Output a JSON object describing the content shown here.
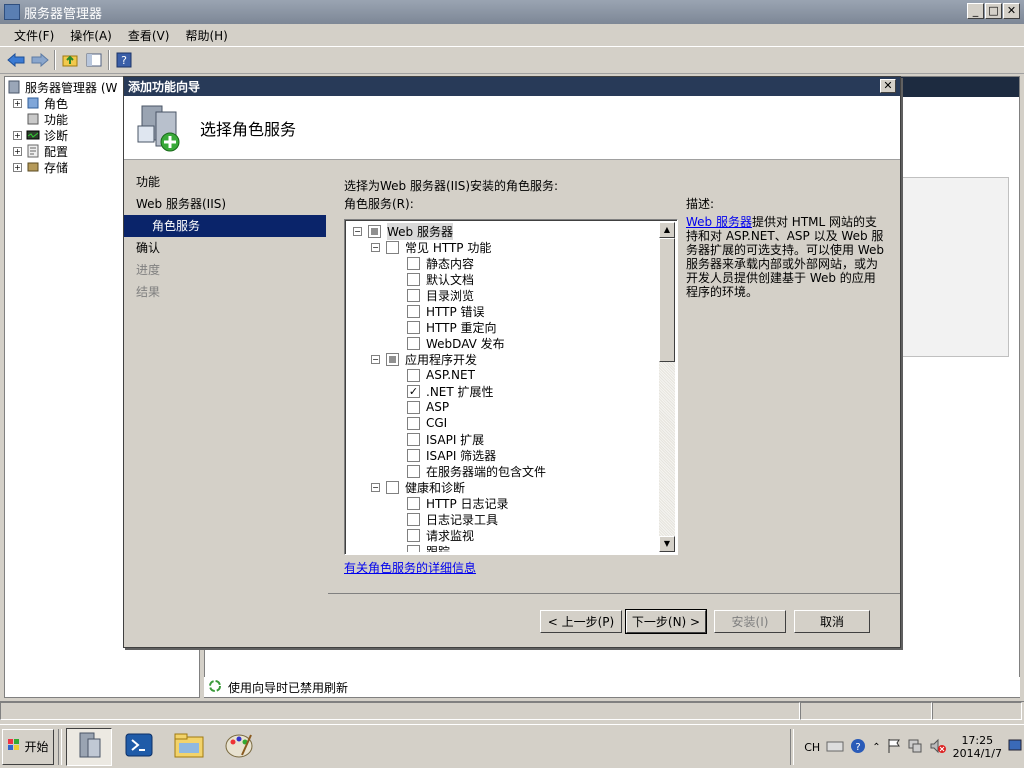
{
  "window": {
    "title": "服务器管理器"
  },
  "menu": [
    "文件(F)",
    "操作(A)",
    "查看(V)",
    "帮助(H)"
  ],
  "tree": {
    "root": "服务器管理器 (W",
    "items": [
      "角色",
      "功能",
      "诊断",
      "配置",
      "存储"
    ]
  },
  "background_status": "使用向导时已禁用刷新",
  "dialog": {
    "title": "添加功能向导",
    "header": "选择角色服务",
    "steps": [
      "功能",
      "Web 服务器(IIS)",
      "角色服务",
      "确认",
      "进度",
      "结果"
    ],
    "prompt": "选择为Web 服务器(IIS)安装的角色服务:",
    "list_label": "角色服务(R):",
    "list_items": [
      {
        "level": 0,
        "expand": "−",
        "check": "partial",
        "label": "Web 服务器"
      },
      {
        "level": 1,
        "expand": "−",
        "check": "unchecked",
        "label": "常见 HTTP 功能"
      },
      {
        "level": 2,
        "check": "unchecked",
        "label": "静态内容"
      },
      {
        "level": 2,
        "check": "unchecked",
        "label": "默认文档"
      },
      {
        "level": 2,
        "check": "unchecked",
        "label": "目录浏览"
      },
      {
        "level": 2,
        "check": "unchecked",
        "label": "HTTP 错误"
      },
      {
        "level": 2,
        "check": "unchecked",
        "label": "HTTP 重定向"
      },
      {
        "level": 2,
        "check": "unchecked",
        "label": "WebDAV 发布"
      },
      {
        "level": 1,
        "expand": "−",
        "check": "partial",
        "label": "应用程序开发"
      },
      {
        "level": 2,
        "check": "unchecked",
        "label": "ASP.NET"
      },
      {
        "level": 2,
        "check": "checked",
        "label": ".NET 扩展性"
      },
      {
        "level": 2,
        "check": "unchecked",
        "label": "ASP"
      },
      {
        "level": 2,
        "check": "unchecked",
        "label": "CGI"
      },
      {
        "level": 2,
        "check": "unchecked",
        "label": "ISAPI 扩展"
      },
      {
        "level": 2,
        "check": "unchecked",
        "label": "ISAPI 筛选器"
      },
      {
        "level": 2,
        "check": "unchecked",
        "label": "在服务器端的包含文件"
      },
      {
        "level": 1,
        "expand": "−",
        "check": "unchecked",
        "label": "健康和诊断"
      },
      {
        "level": 2,
        "check": "unchecked",
        "label": "HTTP 日志记录"
      },
      {
        "level": 2,
        "check": "unchecked",
        "label": "日志记录工具"
      },
      {
        "level": 2,
        "check": "unchecked",
        "label": "请求监视"
      },
      {
        "level": 2,
        "check": "unchecked",
        "label": "跟踪"
      }
    ],
    "more_info_link": "有关角色服务的详细信息",
    "desc_heading": "描述:",
    "desc_link": "Web 服务器",
    "desc_text": "提供对 HTML 网站的支持和对 ASP.NET、ASP 以及 Web 服务器扩展的可选支持。可以使用 Web 服务器来承载内部或外部网站，或为开发人员提供创建基于 Web 的应用程序的环境。",
    "buttons": {
      "prev": "< 上一步(P)",
      "next": "下一步(N) >",
      "install": "安装(I)",
      "cancel": "取消"
    }
  },
  "taskbar": {
    "start": "开始",
    "lang": "CH",
    "time": "17:25",
    "date": "2014/1/7"
  },
  "colors": {
    "selection": "#0a246a",
    "dialog_title": "#283a58",
    "link": "#0000ee"
  }
}
